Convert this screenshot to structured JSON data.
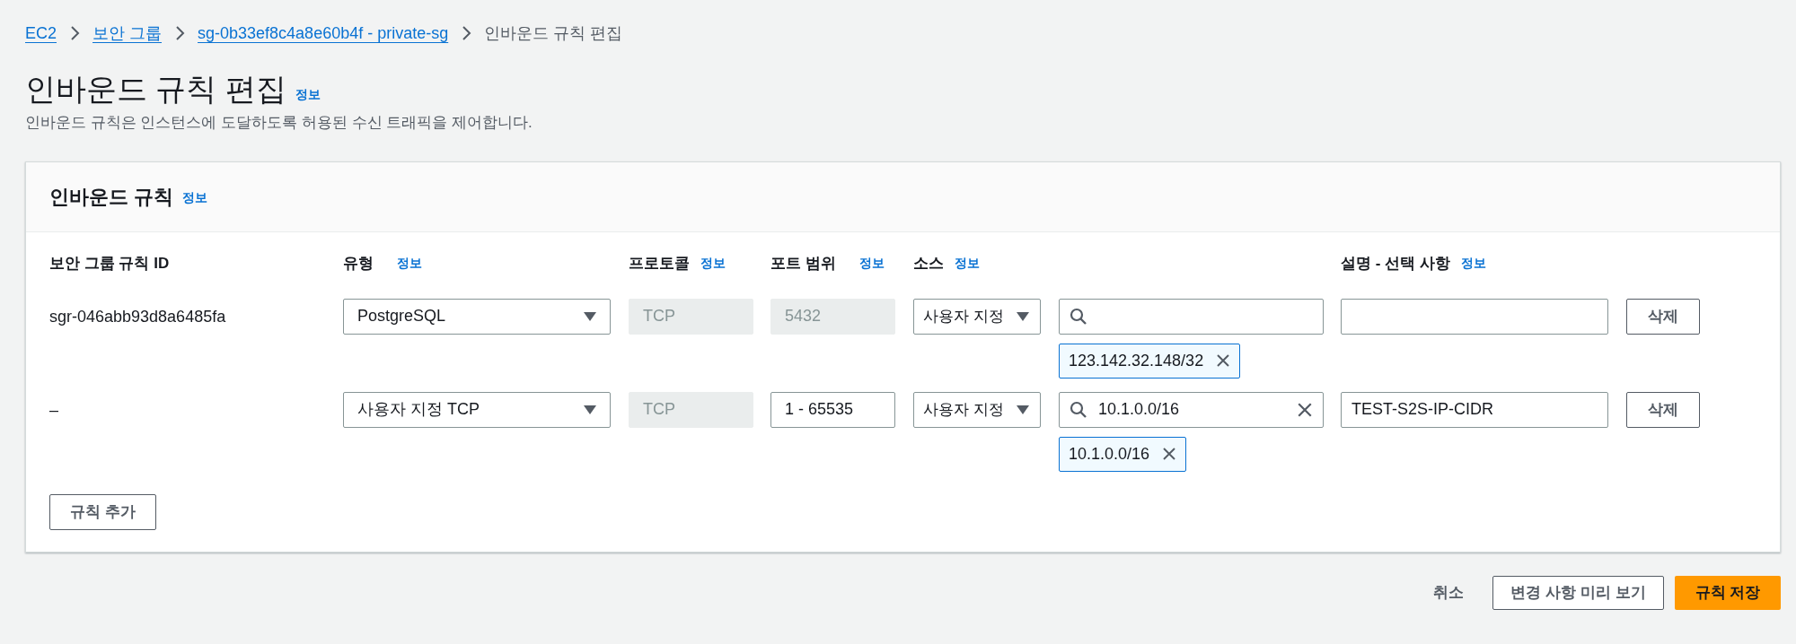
{
  "breadcrumbs": [
    {
      "label": "EC2",
      "link": true
    },
    {
      "label": "보안 그룹",
      "link": true
    },
    {
      "label": "sg-0b33ef8c4a8e60b4f - private-sg",
      "link": true
    },
    {
      "label": "인바운드 규칙 편집",
      "link": false
    }
  ],
  "page": {
    "title": "인바운드 규칙 편집",
    "info": "정보",
    "description": "인바운드 규칙은 인스턴스에 도달하도록 허용된 수신 트래픽을 제어합니다."
  },
  "panel": {
    "title": "인바운드 규칙",
    "info": "정보",
    "columns": [
      {
        "label": "보안 그룹 규칙 ID"
      },
      {
        "label": "유형",
        "info": "정보"
      },
      {
        "label": "프로토콜",
        "info": "정보"
      },
      {
        "label": "포트 범위",
        "info": "정보"
      },
      {
        "label": "소스",
        "info": "정보"
      },
      {},
      {
        "label": "설명 - 선택 사항",
        "info": "정보"
      }
    ],
    "rules": [
      {
        "rule_id": "sgr-046abb93d8a6485fa",
        "type": "PostgreSQL",
        "protocol": {
          "value": "TCP",
          "disabled": true
        },
        "port_range": {
          "value": "5432",
          "disabled": true
        },
        "source_type": "사용자 지정",
        "source_tokens": [
          "123.142.32.148/32"
        ],
        "delete_button": "삭제"
      },
      {
        "rule_id": "–",
        "type": "사용자 지정 TCP",
        "protocol": {
          "value": "TCP",
          "disabled": true
        },
        "port_range": {
          "value": "1 - 65535",
          "disabled": false
        },
        "source_type": "사용자 지정",
        "source_search": "10.1.0.0/16",
        "source_tokens": [
          "10.1.0.0/16"
        ],
        "description": "TEST-S2S-IP-CIDR",
        "delete_button": "삭제"
      }
    ],
    "add_button": "규칙 추가"
  },
  "actions": [
    {
      "label": "취소",
      "kind": "link"
    },
    {
      "label": "변경 사항 미리 보기",
      "kind": "secondary"
    },
    {
      "label": "규칙 저장",
      "kind": "primary"
    }
  ]
}
